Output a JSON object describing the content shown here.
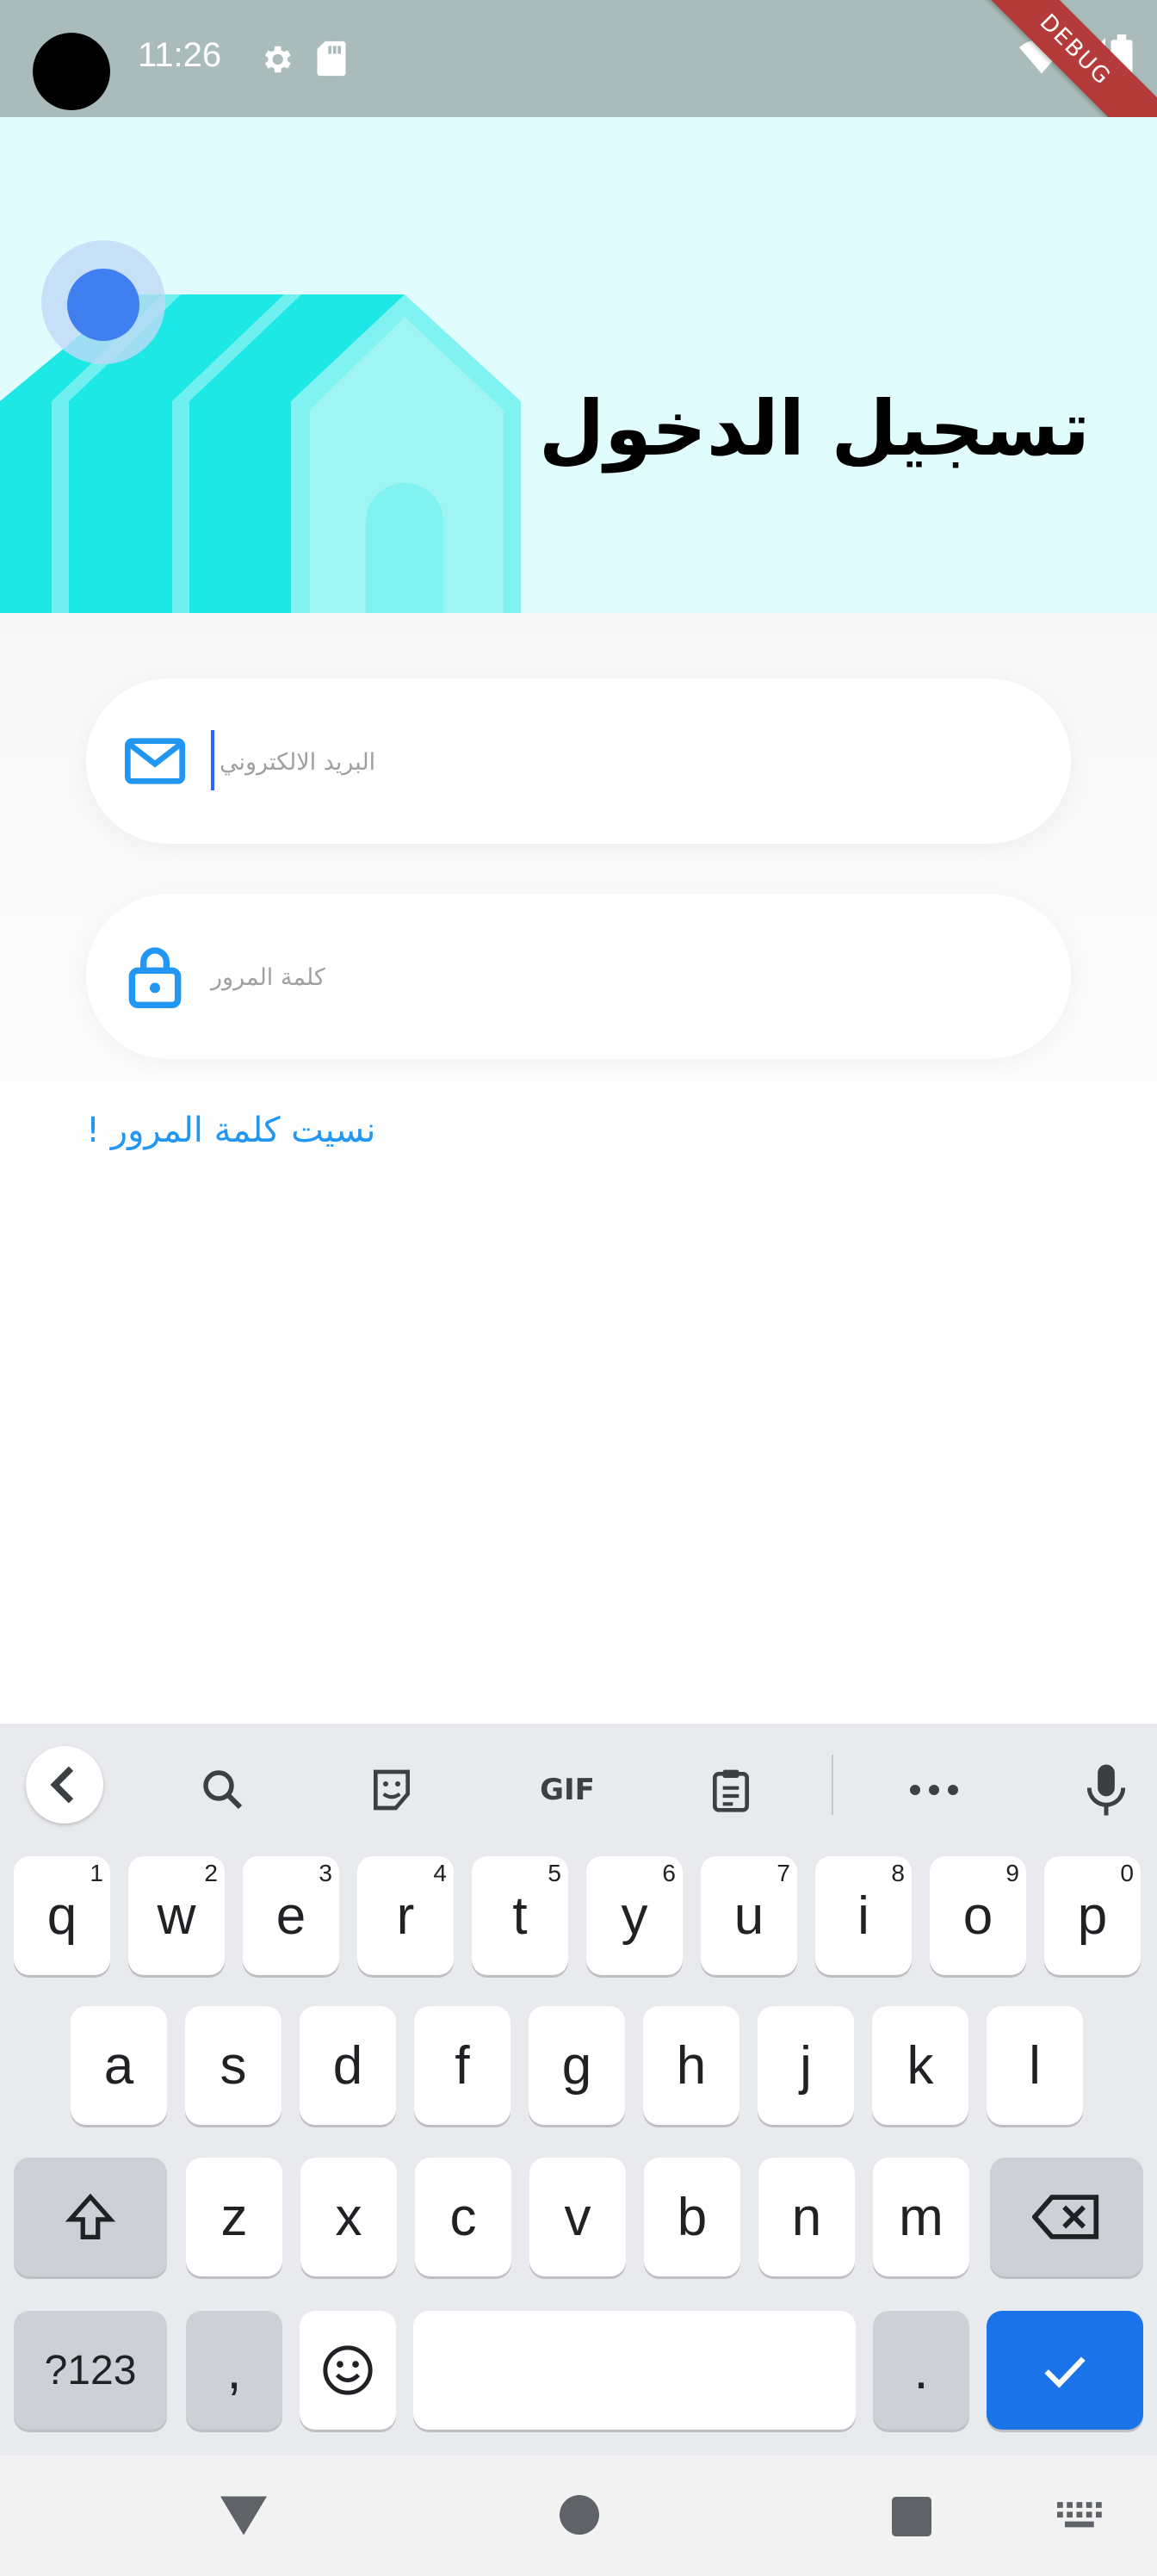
{
  "status_bar": {
    "time": "11:26",
    "debug_label": "DEBUG"
  },
  "header": {
    "title": "تسجيل الدخول"
  },
  "form": {
    "email_placeholder": "البريد الالكتروني",
    "password_placeholder": "كلمة المرور",
    "forgot_password": "نسيت كلمة المرور !"
  },
  "keyboard": {
    "row1": [
      {
        "key": "q",
        "hint": "1"
      },
      {
        "key": "w",
        "hint": "2"
      },
      {
        "key": "e",
        "hint": "3"
      },
      {
        "key": "r",
        "hint": "4"
      },
      {
        "key": "t",
        "hint": "5"
      },
      {
        "key": "y",
        "hint": "6"
      },
      {
        "key": "u",
        "hint": "7"
      },
      {
        "key": "i",
        "hint": "8"
      },
      {
        "key": "o",
        "hint": "9"
      },
      {
        "key": "p",
        "hint": "0"
      }
    ],
    "row2": [
      "a",
      "s",
      "d",
      "f",
      "g",
      "h",
      "j",
      "k",
      "l"
    ],
    "row3": [
      "z",
      "x",
      "c",
      "v",
      "b",
      "n",
      "m"
    ],
    "symbols_label": "?123",
    "comma_label": ",",
    "period_label": ".",
    "gif_label": "GIF"
  },
  "colors": {
    "accent": "#2196f3",
    "header_bg": "#e0fcfc",
    "status_bar_bg": "#a9bcbb",
    "enter_key": "#1a73e8"
  }
}
